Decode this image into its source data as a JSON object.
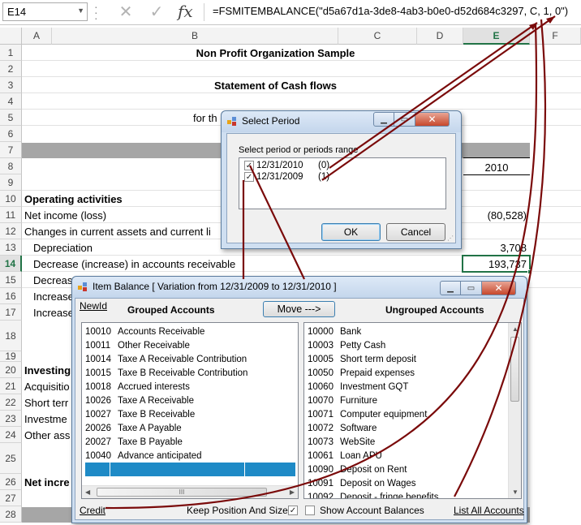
{
  "formula_bar": {
    "name_box": "E14",
    "cancel_glyph": "✕",
    "enter_glyph": "✓",
    "fx_glyph": "fx",
    "formula": "=FSMITEMBALANCE(\"d5a67d1a-3de8-4ab3-b0e0-d52d684c3297, C, 1, 0\")"
  },
  "sheet": {
    "columns": [
      "A",
      "B",
      "C",
      "D",
      "E",
      "F"
    ],
    "rows": [
      {
        "n": "1"
      },
      {
        "n": "2"
      },
      {
        "n": "3"
      },
      {
        "n": "4"
      },
      {
        "n": "5"
      },
      {
        "n": "6"
      },
      {
        "n": "7"
      },
      {
        "n": "8"
      },
      {
        "n": "9"
      },
      {
        "n": "10"
      },
      {
        "n": "11"
      },
      {
        "n": "12"
      },
      {
        "n": "13"
      },
      {
        "n": "14"
      },
      {
        "n": "15"
      },
      {
        "n": "16"
      },
      {
        "n": "17"
      },
      {
        "n": "18"
      },
      {
        "n": "19"
      },
      {
        "n": "20"
      },
      {
        "n": "21"
      },
      {
        "n": "22"
      },
      {
        "n": "23"
      },
      {
        "n": "24"
      },
      {
        "n": "25"
      },
      {
        "n": "26"
      },
      {
        "n": "27"
      },
      {
        "n": "28"
      }
    ],
    "cells": {
      "title": "Non Profit Organization Sample",
      "subtitle": "Statement of Cash flows",
      "period_prefix": "for th",
      "year": "2010",
      "operating": "Operating activities",
      "net_income": "Net income (loss)",
      "net_income_val": "(80,528)",
      "changes": "Changes in current assets and current li",
      "depreciation": "Depreciation",
      "depreciation_val": "3,708",
      "decrease_ar": "Decrease (increase) in accounts receivable",
      "decrease_ar_val": "193,737",
      "r15": "Decreas",
      "r16": "Increase",
      "r17": "Increase",
      "r20": "Investing",
      "r21": "Acquisitio",
      "r22": "Short terr",
      "r23": "Investme",
      "r24": "Other ass",
      "r26": "Net incre"
    }
  },
  "select_period": {
    "title": "Select Period",
    "prompt": "Select period or periods range",
    "periods": [
      {
        "date": "12/31/2010",
        "offset": "(0)",
        "check": "✓"
      },
      {
        "date": "12/31/2009",
        "offset": "(1)",
        "check": "✓"
      }
    ],
    "ok": "OK",
    "cancel": "Cancel"
  },
  "item_balance": {
    "title": "Item Balance [ Variation from 12/31/2009 to 12/31/2010 ]",
    "newid": "NewId",
    "grouped_header": "Grouped Accounts",
    "move_button": "Move --->",
    "ungrouped_header": "Ungrouped Accounts",
    "grouped": [
      {
        "code": "10010",
        "name": "Accounts Receivable"
      },
      {
        "code": "10011",
        "name": "Other Receivable"
      },
      {
        "code": "10014",
        "name": "Taxe A Receivable Contribution"
      },
      {
        "code": "10015",
        "name": "Taxe B Receivable Contribution"
      },
      {
        "code": "10018",
        "name": "Accrued interests"
      },
      {
        "code": "10026",
        "name": "Taxe A Receivable"
      },
      {
        "code": "10027",
        "name": "Taxe B Receivable"
      },
      {
        "code": "20026",
        "name": "Taxe A Payable"
      },
      {
        "code": "20027",
        "name": "Taxe B Payable"
      },
      {
        "code": "10040",
        "name": "Advance anticipated"
      }
    ],
    "ungrouped": [
      {
        "code": "10000",
        "name": "Bank"
      },
      {
        "code": "10003",
        "name": "Petty Cash"
      },
      {
        "code": "10005",
        "name": "Short term deposit"
      },
      {
        "code": "10050",
        "name": "Prepaid expenses"
      },
      {
        "code": "10060",
        "name": "Investment GQT"
      },
      {
        "code": "10070",
        "name": "Furniture"
      },
      {
        "code": "10071",
        "name": "Computer equipment"
      },
      {
        "code": "10072",
        "name": "Software"
      },
      {
        "code": "10073",
        "name": "WebSite"
      },
      {
        "code": "10061",
        "name": "Loan APU"
      },
      {
        "code": "10090",
        "name": "Deposit on Rent"
      },
      {
        "code": "10091",
        "name": "Deposit on Wages"
      },
      {
        "code": "10092",
        "name": "Deposit - fringe benefits"
      }
    ],
    "credit_link": "Credit",
    "keep_position": "Keep Position And Size",
    "keep_check": "✓",
    "show_balances": "Show Account Balances",
    "list_all": "List All Accounts",
    "hscroll_grip": "III"
  },
  "colors": {
    "excel_green": "#217346",
    "arrow_color": "#7a0a0a",
    "band_gray": "#a6a6a6",
    "selection_blue": "#1e8ac6"
  }
}
